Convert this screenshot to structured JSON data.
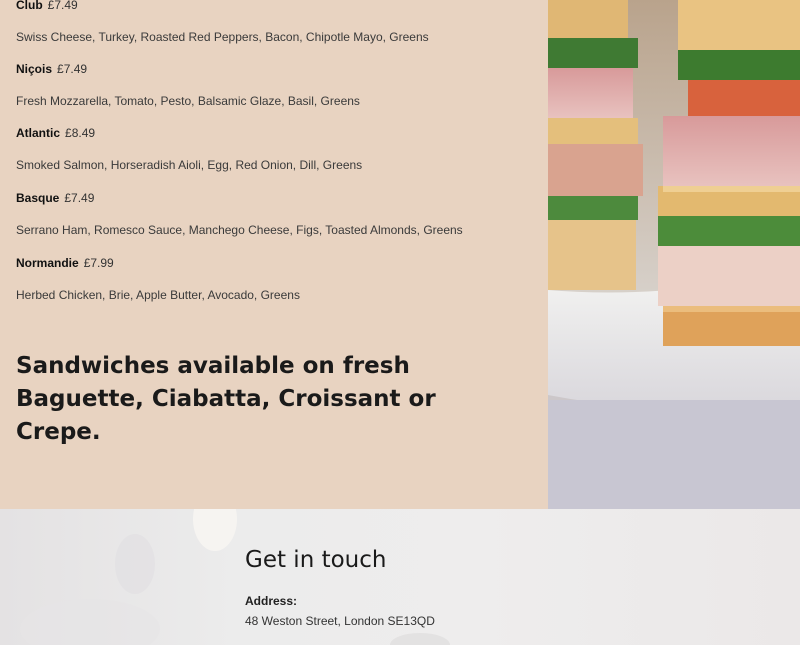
{
  "menu": {
    "items": [
      {
        "name": "Club",
        "price": "£7.49",
        "description": "Swiss Cheese, Turkey, Roasted Red Peppers, Bacon, Chipotle Mayo, Greens"
      },
      {
        "name": "Niçois",
        "price": "£7.49",
        "description": "Fresh Mozzarella, Tomato, Pesto, Balsamic Glaze, Basil, Greens"
      },
      {
        "name": "Atlantic",
        "price": "£8.49",
        "description": "Smoked Salmon, Horseradish Aioli, Egg, Red Onion, Dill, Greens"
      },
      {
        "name": "Basque",
        "price": "£7.49",
        "description": "Serrano Ham, Romesco Sauce, Manchego Cheese, Figs, Toasted Almonds, Greens"
      },
      {
        "name": "Normandie",
        "price": "£7.99",
        "description": "Herbed Chicken, Brie, Apple Butter, Avocado, Greens"
      }
    ],
    "headline": "Sandwiches available on fresh Baguette, Ciabatta, Croissant or Crepe."
  },
  "contact": {
    "title": "Get in touch",
    "address_label": "Address:",
    "address_value": "48 Weston Street, London SE13QD"
  },
  "colors": {
    "menu_background": "#e8d3c1",
    "contact_background": "#ececec"
  }
}
